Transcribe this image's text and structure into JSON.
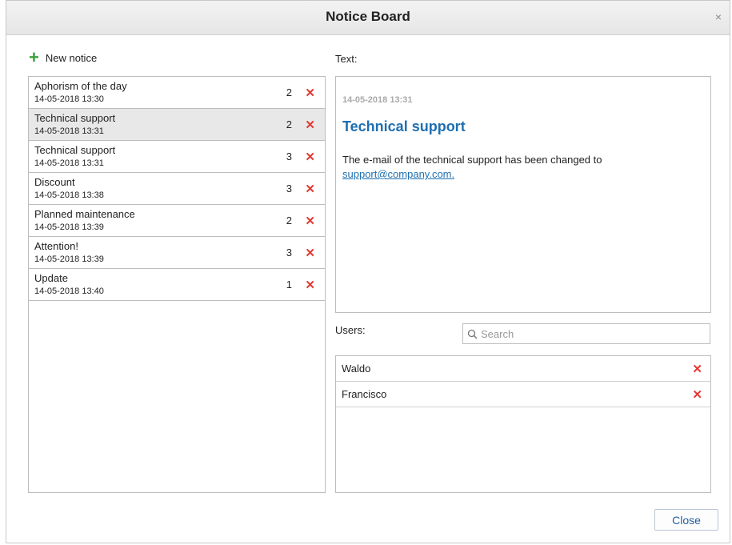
{
  "dialog": {
    "title": "Notice Board",
    "close_glyph": "×",
    "close_button_label": "Close"
  },
  "toolbar": {
    "new_notice_label": "New notice",
    "new_notice_icon": "+"
  },
  "notices": [
    {
      "title": "Aphorism of the day",
      "date": "14-05-2018 13:30",
      "count": "2",
      "selected": false
    },
    {
      "title": "Technical support",
      "date": "14-05-2018 13:31",
      "count": "2",
      "selected": true
    },
    {
      "title": "Technical support",
      "date": "14-05-2018 13:31",
      "count": "3",
      "selected": false
    },
    {
      "title": "Discount",
      "date": "14-05-2018 13:38",
      "count": "3",
      "selected": false
    },
    {
      "title": "Planned maintenance",
      "date": "14-05-2018 13:39",
      "count": "2",
      "selected": false
    },
    {
      "title": "Attention!",
      "date": "14-05-2018 13:39",
      "count": "3",
      "selected": false
    },
    {
      "title": "Update",
      "date": "14-05-2018 13:40",
      "count": "1",
      "selected": false
    }
  ],
  "delete_glyph": "✕",
  "text_section": {
    "label": "Text:",
    "date": "14-05-2018 13:31",
    "title": "Technical support",
    "body": "The e-mail of the technical support has been changed to",
    "link": "support@company.com."
  },
  "users_section": {
    "label": "Users:",
    "search_placeholder": "Search",
    "users": [
      "Waldo",
      "Francisco"
    ]
  },
  "colors": {
    "accent": "#1f6fb0",
    "delete": "#e53935",
    "add": "#3aa13a",
    "selected_row": "#e8e8e8"
  }
}
